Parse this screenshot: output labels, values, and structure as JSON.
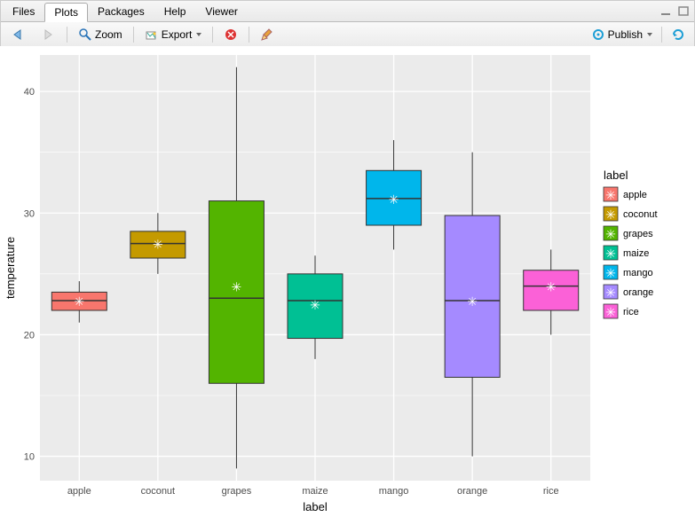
{
  "tabs": {
    "files": "Files",
    "plots": "Plots",
    "packages": "Packages",
    "help": "Help",
    "viewer": "Viewer",
    "active": "plots"
  },
  "toolbar": {
    "zoom_label": "Zoom",
    "export_label": "Export",
    "publish_label": "Publish"
  },
  "chart_data": {
    "type": "boxplot",
    "xlabel": "label",
    "ylabel": "temperature",
    "legend_title": "label",
    "y_ticks": [
      10,
      20,
      30,
      40
    ],
    "categories": [
      "apple",
      "coconut",
      "grapes",
      "maize",
      "mango",
      "orange",
      "rice"
    ],
    "colors": {
      "apple": "#f8766d",
      "coconut": "#c49a00",
      "grapes": "#53b400",
      "maize": "#00c094",
      "mango": "#00b6eb",
      "orange": "#a58aff",
      "rice": "#fb61d7"
    },
    "series": [
      {
        "name": "apple",
        "min": 21.0,
        "q1": 22.0,
        "median": 22.8,
        "q3": 23.5,
        "max": 24.4,
        "mean": 22.8,
        "outliers": []
      },
      {
        "name": "coconut",
        "min": 25.0,
        "q1": 26.3,
        "median": 27.5,
        "q3": 28.5,
        "max": 30.0,
        "mean": 27.5,
        "outliers": []
      },
      {
        "name": "grapes",
        "min": 9.0,
        "q1": 16.0,
        "median": 23.0,
        "q3": 31.0,
        "max": 42.0,
        "mean": 24.0,
        "outliers": []
      },
      {
        "name": "maize",
        "min": 18.0,
        "q1": 19.7,
        "median": 22.8,
        "q3": 25.0,
        "max": 26.5,
        "mean": 22.5,
        "outliers": []
      },
      {
        "name": "mango",
        "min": 27.0,
        "q1": 29.0,
        "median": 31.2,
        "q3": 33.5,
        "max": 36.0,
        "mean": 31.2,
        "outliers": []
      },
      {
        "name": "orange",
        "min": 10.0,
        "q1": 16.5,
        "median": 22.8,
        "q3": 29.8,
        "max": 35.0,
        "mean": 22.8,
        "outliers": []
      },
      {
        "name": "rice",
        "min": 20.0,
        "q1": 22.0,
        "median": 24.0,
        "q3": 25.3,
        "max": 27.0,
        "mean": 24.0,
        "outliers": []
      }
    ],
    "ylim": [
      8,
      43
    ]
  }
}
